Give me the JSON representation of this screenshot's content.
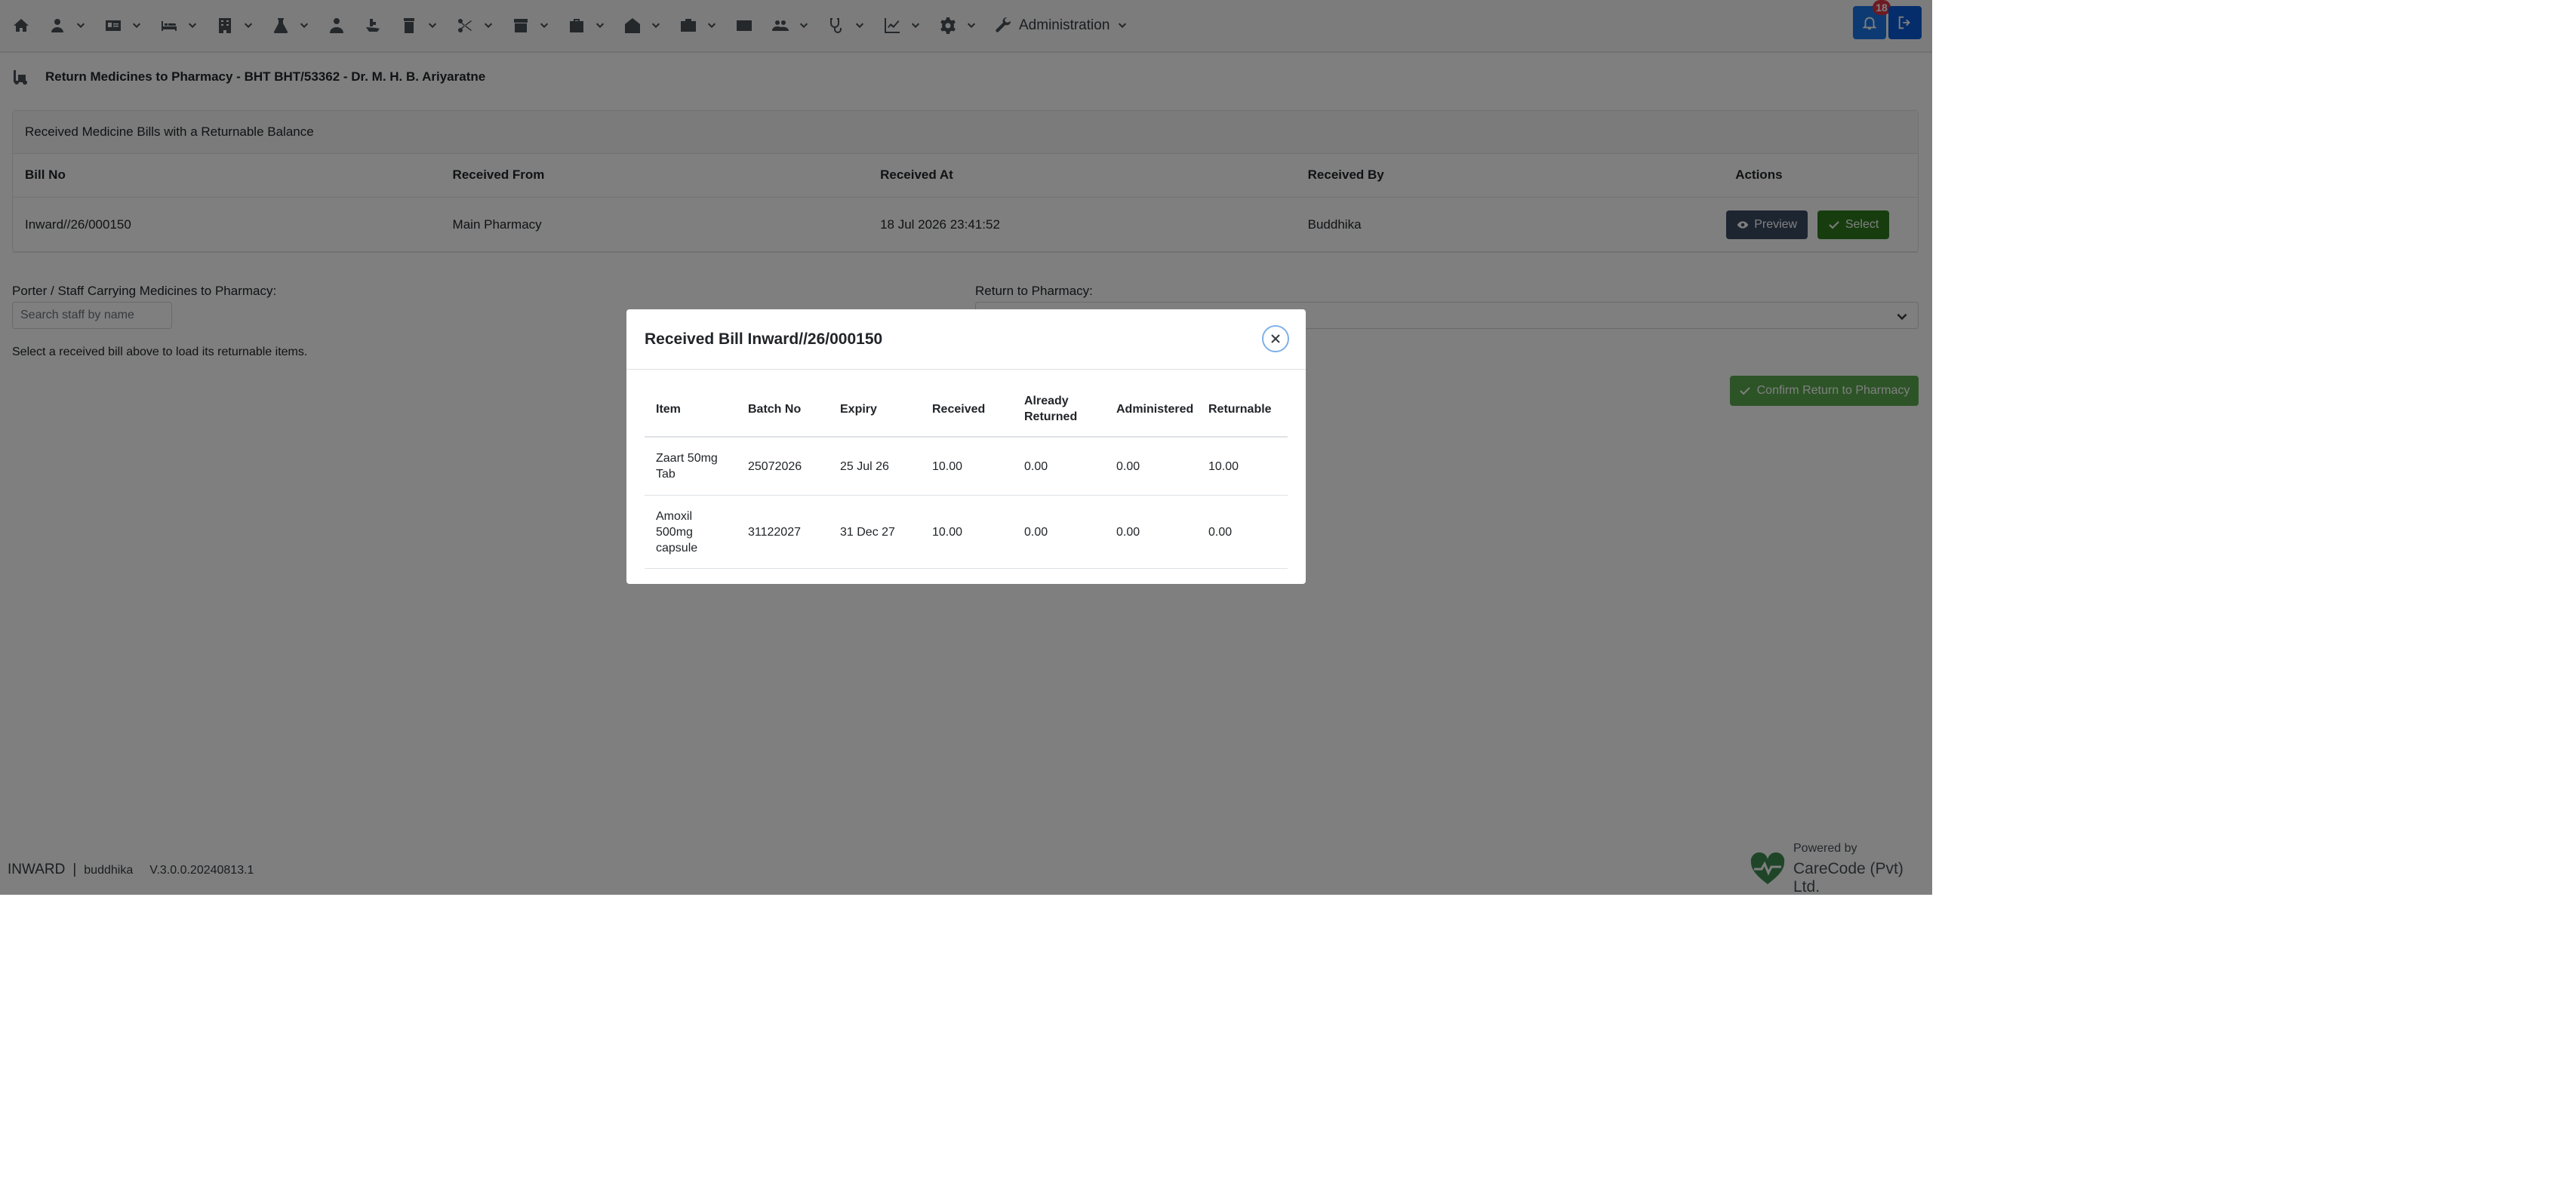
{
  "nav": {
    "admin_label": "Administration",
    "notification_count": "18",
    "icons": [
      "home-icon",
      "user-tie-icon",
      "id-card-icon",
      "bed-icon",
      "building-icon",
      "flask-icon",
      "user-doctor-icon",
      "hand-medical-icon",
      "prescription-bottle-icon",
      "scissors-icon",
      "store-icon",
      "briefcase-medical-icon",
      "clinic-icon",
      "camera-icon",
      "envelope-icon",
      "users-icon",
      "stethoscope-icon",
      "chart-icon",
      "gear-icon",
      "wrench-icon"
    ]
  },
  "page": {
    "title": "Return Medicines to Pharmacy - BHT BHT/53362 - Dr. M. H. B. Ariyaratne",
    "card_header": "Received Medicine Bills with a Returnable Balance",
    "bills_table": {
      "columns": [
        "Bill No",
        "Received From",
        "Received At",
        "Received By",
        "Actions"
      ],
      "rows": [
        {
          "bill_no": "Inward//26/000150",
          "received_from": "Main Pharmacy",
          "received_at": "18 Jul 2026 23:41:52",
          "received_by": "Buddhika"
        }
      ],
      "preview_label": "Preview",
      "select_label": "Select"
    },
    "porter_label": "Porter / Staff Carrying Medicines to Pharmacy:",
    "porter_placeholder": "Search staff by name",
    "return_label": "Return to Pharmacy:",
    "hint": "Select a received bill above to load its returnable items.",
    "confirm_label": "Confirm Return to Pharmacy"
  },
  "footer": {
    "module": "INWARD",
    "separator": "|",
    "user": "buddhika",
    "version": "V.3.0.0.20240813.1",
    "powered_by": "Powered by",
    "company": "CareCode (Pvt) Ltd."
  },
  "modal": {
    "title": "Received Bill Inward//26/000150",
    "columns": [
      "Item",
      "Batch No",
      "Expiry",
      "Received",
      "Already Returned",
      "Administered",
      "Returnable"
    ],
    "rows": [
      {
        "item": "Zaart 50mg Tab",
        "batch": "25072026",
        "expiry": "25 Jul 26",
        "received": "10.00",
        "returned": "0.00",
        "administered": "0.00",
        "returnable": "10.00"
      },
      {
        "item": "Amoxil 500mg capsule",
        "batch": "31122027",
        "expiry": "31 Dec 27",
        "received": "10.00",
        "returned": "0.00",
        "administered": "0.00",
        "returnable": "0.00"
      }
    ]
  }
}
